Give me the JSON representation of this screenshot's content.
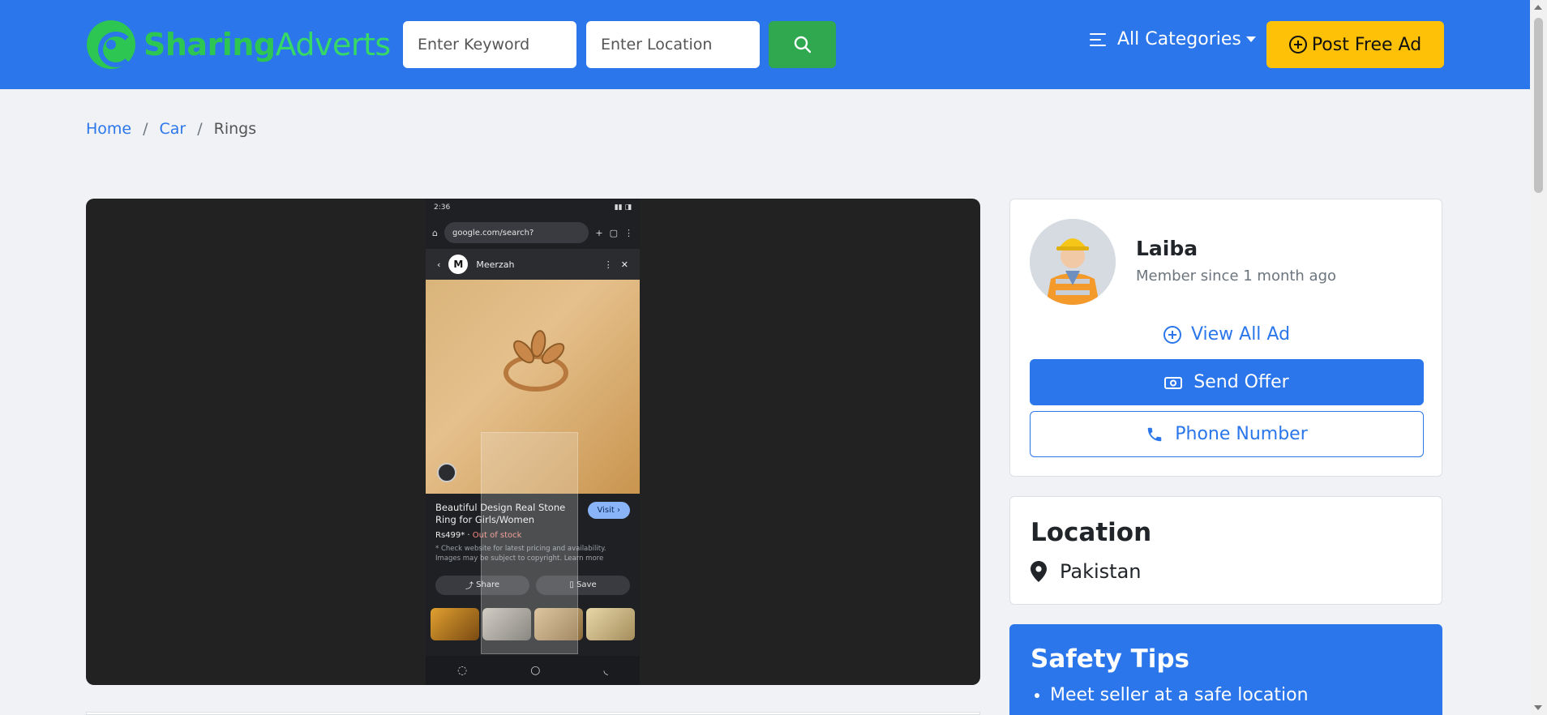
{
  "header": {
    "logo_part1": "Sharing",
    "logo_part2": "Adverts",
    "keyword_placeholder": "Enter Keyword",
    "location_placeholder": "Enter Location",
    "categories_label": "All Categories",
    "post_ad_label": "Post Free Ad",
    "colors": {
      "bar": "#2a76ea",
      "logo_green": "#2dc653",
      "search_button": "#2fa84f",
      "post_button": "#ffc107"
    }
  },
  "breadcrumb": {
    "items": [
      "Home",
      "Car"
    ],
    "current": "Rings",
    "separator": "/"
  },
  "ad_image": {
    "status_time": "2:36",
    "url": "google.com/search?",
    "source_name": "Meerzah",
    "source_initial": "M",
    "product_title": "Beautiful Design Real Stone Ring for Girls/Women",
    "price": "Rs499*",
    "stock": "Out of stock",
    "note": "* Check website for latest pricing and availability. Images may be subject to copyright. Learn more",
    "visit_label": "Visit",
    "share_label": "Share",
    "save_label": "Save"
  },
  "seller": {
    "name": "Laiba",
    "member_since": "Member since 1 month ago",
    "view_all_label": "View All Ad",
    "send_offer_label": "Send Offer",
    "phone_label": "Phone Number"
  },
  "location": {
    "title": "Location",
    "value": "Pakistan"
  },
  "safety": {
    "title": "Safety Tips",
    "tips": [
      "Meet seller at a safe location"
    ]
  }
}
